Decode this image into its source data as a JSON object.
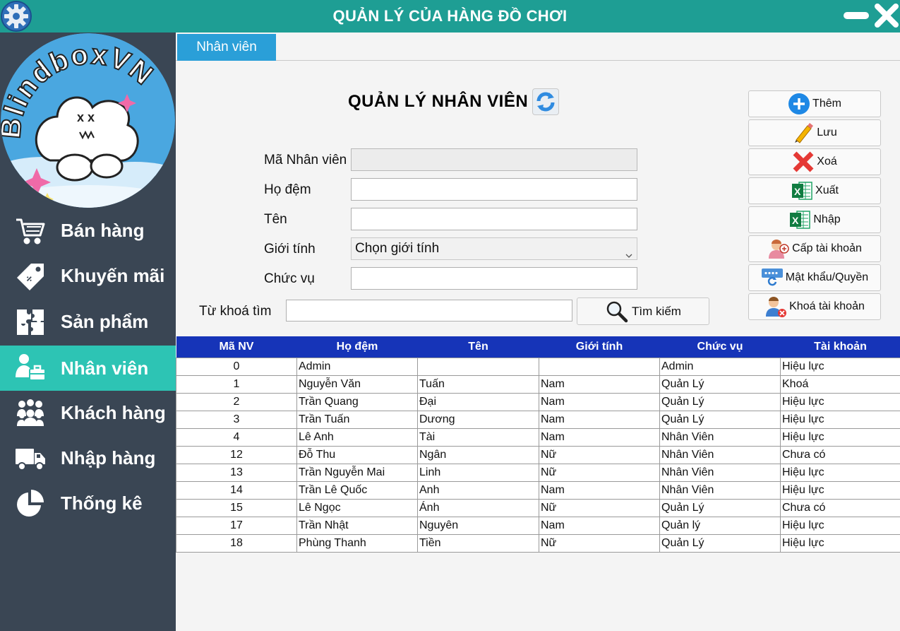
{
  "app": {
    "title": "QUẢN LÝ CỦA HÀNG ĐỒ CHƠI"
  },
  "logo": {
    "text": "BlindboxVN"
  },
  "sidebar": {
    "items": [
      {
        "label": "Bán hàng",
        "icon": "cart-icon",
        "active": false
      },
      {
        "label": "Khuyến mãi",
        "icon": "tag-icon",
        "active": false
      },
      {
        "label": "Sản phẩm",
        "icon": "puzzle-icon",
        "active": false
      },
      {
        "label": "Nhân viên",
        "icon": "employee-icon",
        "active": true
      },
      {
        "label": "Khách hàng",
        "icon": "customers-icon",
        "active": false
      },
      {
        "label": "Nhập hàng",
        "icon": "truck-icon",
        "active": false
      },
      {
        "label": "Thống kê",
        "icon": "pie-chart-icon",
        "active": false
      }
    ]
  },
  "tab": {
    "label": "Nhân viên"
  },
  "form": {
    "heading": "QUẢN LÝ NHÂN VIÊN",
    "ma_nv_label": "Mã Nhân viên",
    "ma_nv_value": "",
    "ho_dem_label": "Họ đệm",
    "ho_dem_value": "",
    "ten_label": "Tên",
    "ten_value": "",
    "gioi_tinh_label": "Giới tính",
    "gioi_tinh_selected": "Chọn giới tính",
    "chuc_vu_label": "Chức vụ",
    "chuc_vu_value": "",
    "keyword_label": "Từ khoá tìm",
    "keyword_value": "",
    "search_label": "Tìm kiếm"
  },
  "actions": {
    "add": "Thêm",
    "save": "Lưu",
    "delete": "Xoá",
    "export": "Xuất",
    "import": "Nhập",
    "grant": "Cấp tài khoản",
    "password": "Mật khẩu/Quyền",
    "lock": "Khoá tài khoản"
  },
  "table": {
    "headers": [
      "Mã NV",
      "Họ đệm",
      "Tên",
      "Giới tính",
      "Chức vụ",
      "Tài khoản"
    ],
    "rows": [
      [
        "0",
        "Admin",
        "",
        "",
        "Admin",
        "Hiệu lực"
      ],
      [
        "1",
        "Nguyễn Văn",
        "Tuấn",
        "Nam",
        "Quản Lý",
        "Khoá"
      ],
      [
        "2",
        "Trần Quang",
        "Đại",
        "Nam",
        "Quản Lý",
        "Hiệu lực"
      ],
      [
        "3",
        "Trần Tuấn",
        "Dương",
        "Nam",
        "Quản Lý",
        "Hiệu lực"
      ],
      [
        "4",
        "Lê Anh",
        "Tài",
        "Nam",
        "Nhân Viên",
        "Hiệu lực"
      ],
      [
        "12",
        "Đỗ Thu",
        "Ngân",
        "Nữ",
        "Nhân Viên",
        "Chưa có"
      ],
      [
        "13",
        "Trần Nguyễn Mai",
        "Linh",
        "Nữ",
        "Nhân Viên",
        "Hiệu lực"
      ],
      [
        "14",
        "Trần Lê Quốc",
        "Anh",
        "Nam",
        "Nhân Viên",
        "Hiệu lực"
      ],
      [
        "15",
        "Lê Ngọc",
        "Ánh",
        "Nữ",
        "Quản Lý",
        "Chưa có"
      ],
      [
        "17",
        "Trần Nhật",
        "Nguyên",
        "Nam",
        "Quản lý",
        "Hiệu lực"
      ],
      [
        "18",
        "Phùng Thanh",
        "Tiền",
        "Nữ",
        "Quản Lý",
        "Hiệu lực"
      ]
    ]
  },
  "colors": {
    "titlebar": "#1e9e94",
    "sidebar": "#3a4654",
    "sidebar_active": "#2dc4b4",
    "tab": "#2a9fd8",
    "table_header": "#1634b8"
  }
}
